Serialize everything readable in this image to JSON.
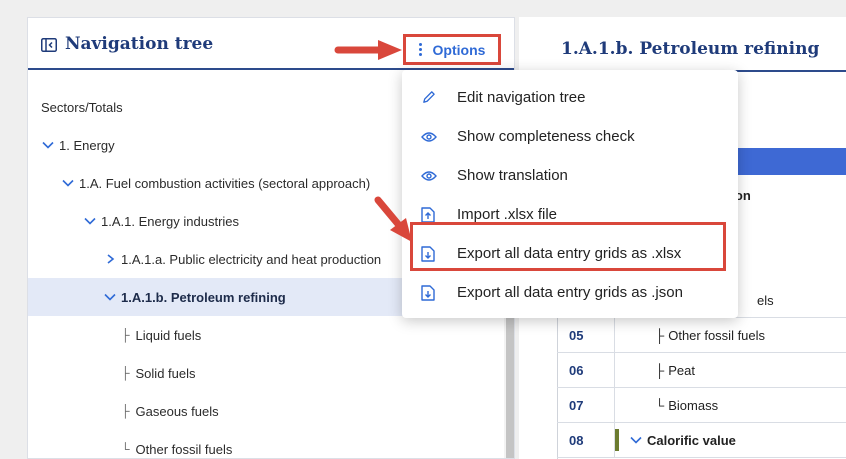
{
  "navigation": {
    "title": "Navigation tree",
    "options_label": "Options",
    "tree": [
      {
        "prefix": "",
        "label": "Sectors/Totals",
        "chevron": "none",
        "selected": false
      },
      {
        "prefix": "",
        "label": "1. Energy",
        "chevron": "down",
        "selected": false
      },
      {
        "prefix": "",
        "label": "1.A. Fuel combustion activities (sectoral approach)",
        "chevron": "down",
        "selected": false
      },
      {
        "prefix": "",
        "label": "1.A.1. Energy industries",
        "chevron": "down",
        "selected": false
      },
      {
        "prefix": "",
        "label": "1.A.1.a. Public electricity and heat production",
        "chevron": "right",
        "selected": false
      },
      {
        "prefix": "",
        "label": "1.A.1.b. Petroleum refining",
        "chevron": "down",
        "selected": true
      },
      {
        "prefix": "├",
        "label": "Liquid fuels",
        "chevron": "none",
        "selected": false
      },
      {
        "prefix": "├",
        "label": "Solid fuels",
        "chevron": "none",
        "selected": false
      },
      {
        "prefix": "├",
        "label": "Gaseous fuels",
        "chevron": "none",
        "selected": false
      },
      {
        "prefix": "└",
        "label": "Other fossil fuels",
        "chevron": "none",
        "selected": false
      }
    ]
  },
  "content": {
    "title": "1.A.1.b. Petroleum refining",
    "column_header_fragment": "ption",
    "rows": [
      {
        "num": "",
        "label": "els",
        "prefix": ""
      },
      {
        "num": "05",
        "label": "Other fossil fuels",
        "prefix": "├"
      },
      {
        "num": "06",
        "label": "Peat",
        "prefix": "├"
      },
      {
        "num": "07",
        "label": "Biomass",
        "prefix": "└"
      },
      {
        "num": "08",
        "label": "Calorific value",
        "prefix": ""
      }
    ]
  },
  "options_menu": {
    "items": [
      {
        "label": "Edit navigation tree",
        "icon": "pencil-icon"
      },
      {
        "label": "Show completeness check",
        "icon": "eye-icon"
      },
      {
        "label": "Show translation",
        "icon": "eye-icon"
      },
      {
        "label": "Import .xlsx file",
        "icon": "file-upload-icon"
      },
      {
        "label": "Export all data entry grids as .xlsx",
        "icon": "file-download-icon"
      },
      {
        "label": "Export all data entry grids as .json",
        "icon": "file-download-icon"
      }
    ],
    "highlighted_item": "Export all data entry grids as .xlsx"
  },
  "colors": {
    "accent_blue": "#2f6ad6",
    "title_navy": "#1f3b7a",
    "highlight_red": "#d9473b",
    "selected_bg": "#e3e9f7"
  }
}
